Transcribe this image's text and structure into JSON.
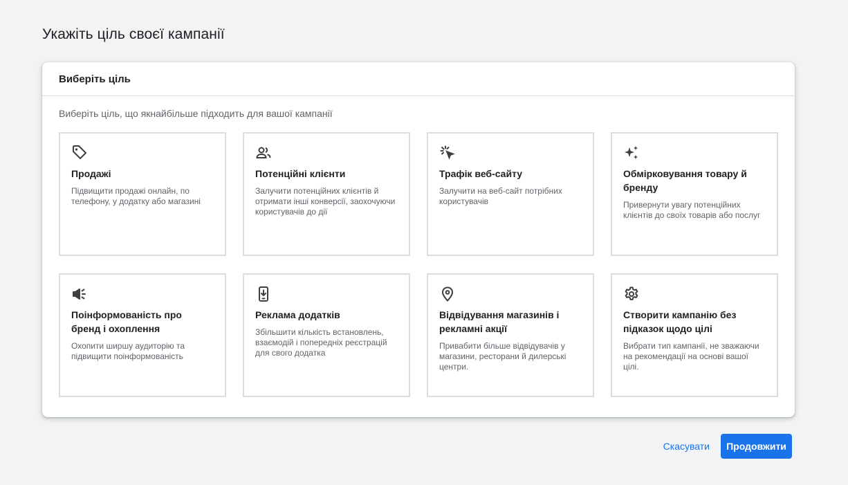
{
  "page": {
    "title": "Укажіть ціль своєї кампанії"
  },
  "card": {
    "header": "Виберіть ціль",
    "subtitle": "Виберіть ціль, що якнайбільше підходить для вашої кампанії",
    "goals": [
      {
        "icon": "tag-icon",
        "title": "Продажі",
        "description": "Підвищити продажі онлайн, по телефону, у додатку або магазині"
      },
      {
        "icon": "people-icon",
        "title": "Потенційні клієнти",
        "description": "Залучити потенційних клієнтів й отримати інші конверсії, заохочуючи користувачів до дії"
      },
      {
        "icon": "click-cursor-icon",
        "title": "Трафік веб-сайту",
        "description": "Залучити на веб-сайт потрібних користувачів"
      },
      {
        "icon": "sparkle-icon",
        "title": "Обмірковування товару й бренду",
        "description": "Привернути увагу потенційних клієнтів до своїх товарів або послуг"
      },
      {
        "icon": "megaphone-icon",
        "title": "Поінформованість про бренд і охоплення",
        "description": "Охопити ширшу аудиторію та підвищити поінформованість"
      },
      {
        "icon": "phone-download-icon",
        "title": "Реклама додатків",
        "description": "Збільшити кількість встановлень, взаємодій і попередніх реєстрацій для свого додатка"
      },
      {
        "icon": "location-pin-icon",
        "title": "Відвідування магазинів і рекламні акції",
        "description": "Привабити більше відвідувачів у магазини, ресторани й дилерські центри."
      },
      {
        "icon": "gear-icon",
        "title": "Створити кампанію без підказок щодо цілі",
        "description": "Вибрати тип кампанії, не зважаючи на рекомендації на основі вашої цілі."
      }
    ]
  },
  "footer": {
    "cancel_label": "Скасувати",
    "continue_label": "Продовжити"
  },
  "colors": {
    "accent": "#1a73e8",
    "border": "#dadce0",
    "text_secondary": "#5f6368"
  }
}
